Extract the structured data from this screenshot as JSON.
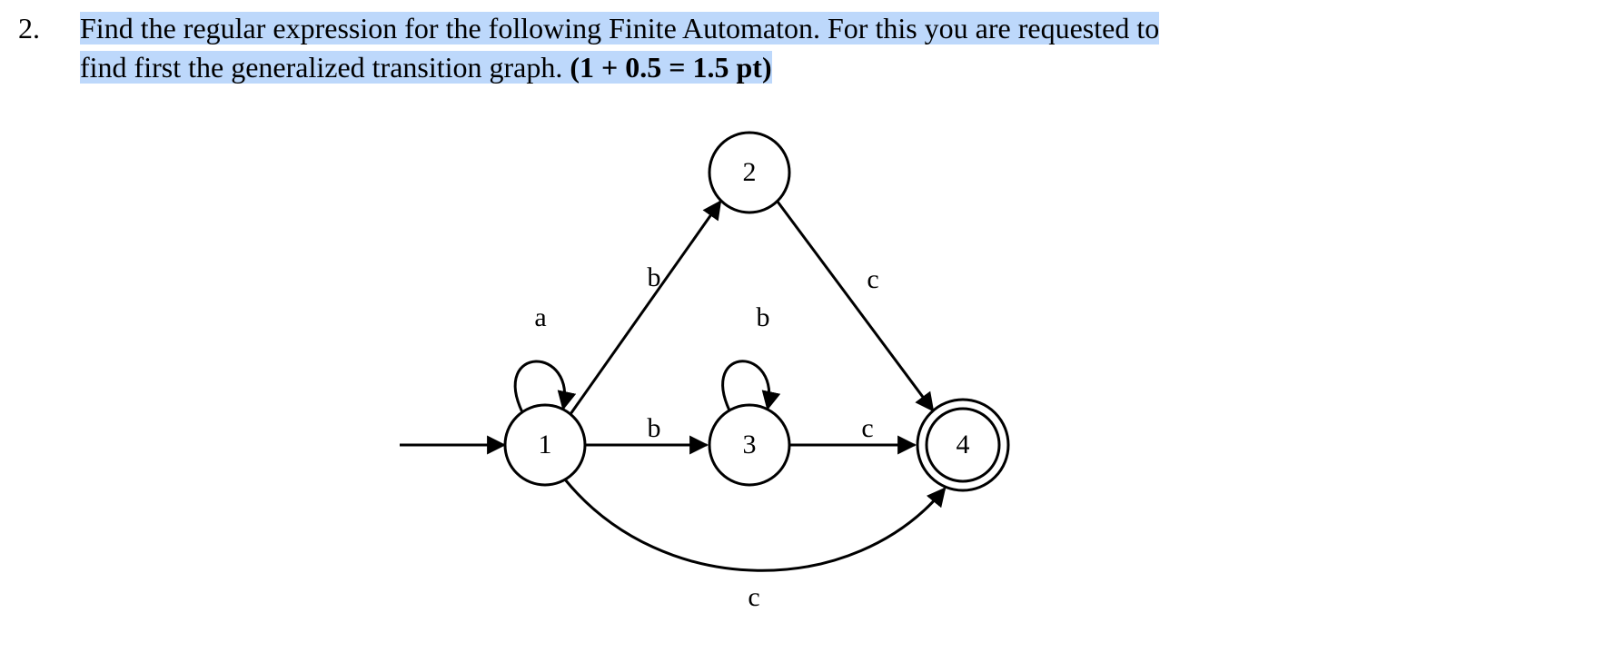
{
  "question": {
    "number": "2.",
    "line1": "Find the regular expression for the following Finite Automaton. For this you are requested to",
    "line2_prefix": "find first the generalized transition graph. ",
    "points": "(1 + 0.5 = 1.5 pt)"
  },
  "states": {
    "s1": "1",
    "s2": "2",
    "s3": "3",
    "s4": "4"
  },
  "labels": {
    "loop1": "a",
    "loop3": "b",
    "e12": "b",
    "e13": "b",
    "e14": "c",
    "e24": "c",
    "e34": "c"
  },
  "automaton": {
    "start": "1",
    "accepting": [
      "4"
    ],
    "transitions": [
      {
        "from": "1",
        "to": "1",
        "symbol": "a"
      },
      {
        "from": "1",
        "to": "2",
        "symbol": "b"
      },
      {
        "from": "1",
        "to": "3",
        "symbol": "b"
      },
      {
        "from": "1",
        "to": "4",
        "symbol": "c"
      },
      {
        "from": "2",
        "to": "4",
        "symbol": "c"
      },
      {
        "from": "3",
        "to": "3",
        "symbol": "b"
      },
      {
        "from": "3",
        "to": "4",
        "symbol": "c"
      }
    ]
  }
}
